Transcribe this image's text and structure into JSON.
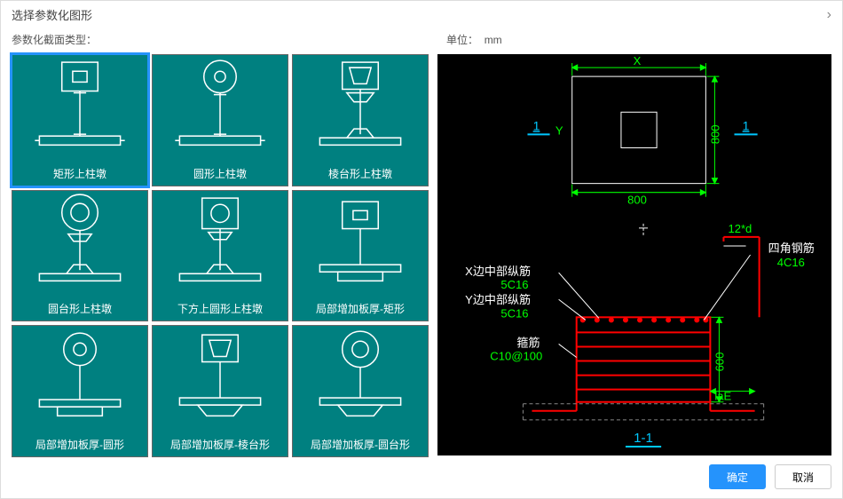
{
  "dialog": {
    "title": "选择参数化图形",
    "type_label": "参数化截面类型：",
    "unit_label": "单位：",
    "unit_value": "mm"
  },
  "tiles": [
    {
      "label": "矩形上柱墩",
      "selected": true
    },
    {
      "label": "圆形上柱墩",
      "selected": false
    },
    {
      "label": "棱台形上柱墩",
      "selected": false
    },
    {
      "label": "圆台形上柱墩",
      "selected": false
    },
    {
      "label": "下方上圆形上柱墩",
      "selected": false
    },
    {
      "label": "局部增加板厚-矩形",
      "selected": false
    },
    {
      "label": "局部增加板厚-圆形",
      "selected": false
    },
    {
      "label": "局部增加板厚-棱台形",
      "selected": false
    },
    {
      "label": "局部增加板厚-圆台形",
      "selected": false
    }
  ],
  "preview": {
    "dim_x_label": "X",
    "dim_y_label": "Y",
    "top_width": "800",
    "top_height": "800",
    "section_mark": "1",
    "section_label": "1-1",
    "labels": {
      "x_rebar": "X边中部纵筋",
      "x_rebar_val": "5C16",
      "y_rebar": "Y边中部纵筋",
      "y_rebar_val": "5C16",
      "stirrup": "箍筋",
      "stirrup_val": "C10@100",
      "corner": "四角钢筋",
      "corner_val": "4C16",
      "hook": "12*d",
      "anchor": "laE",
      "height": "600"
    }
  },
  "buttons": {
    "ok": "确定",
    "cancel": "取消"
  }
}
